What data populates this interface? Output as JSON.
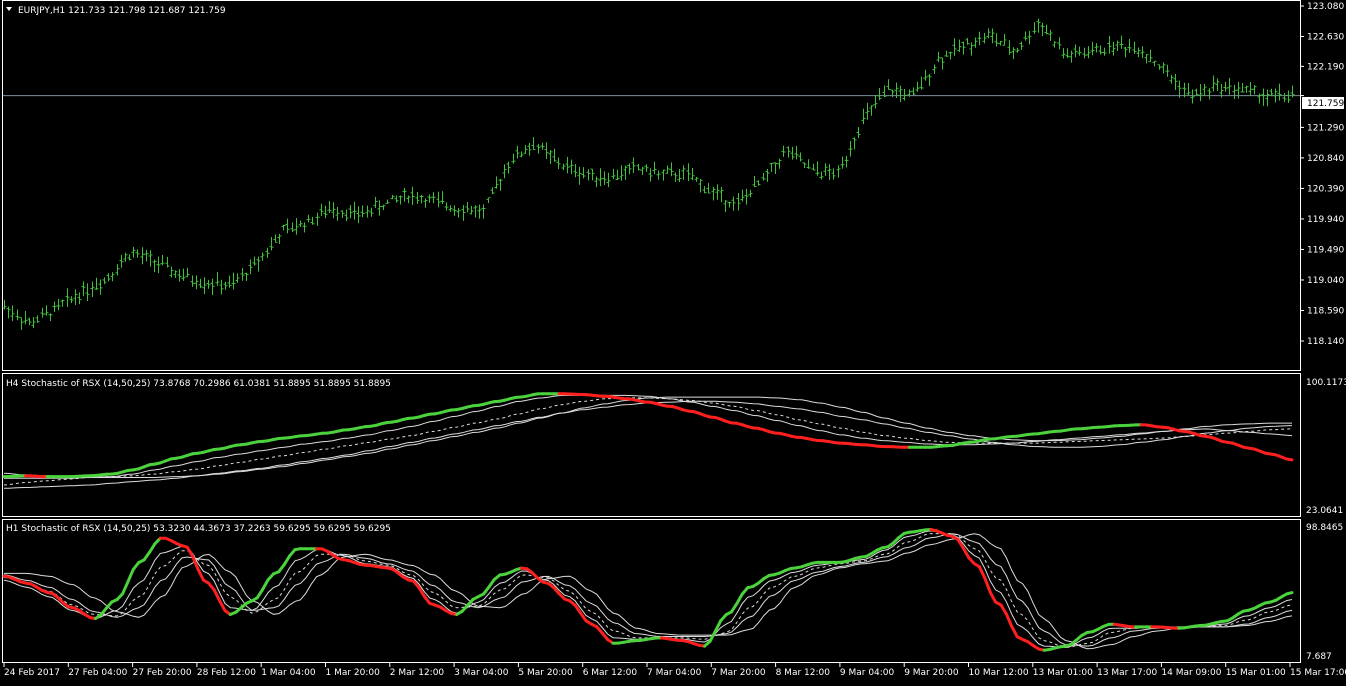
{
  "colors": {
    "background": "#000000",
    "frame": "#ffffff",
    "candle": "#41c03c",
    "rising": "#4bd23d",
    "falling": "#ff1f1f",
    "band": "#dcdcdc",
    "price_line": "#7d8ba0"
  },
  "main": {
    "symbol_menu_icon": "triangle-down-icon",
    "header": "EURJPY,H1  121.733 121.798 121.687 121.759",
    "price_tag": "121.759"
  },
  "h4": {
    "header": "H4 Stochastic of RSX (14,50,25) 73.8768 70.2986 61.0381 51.8895 51.8895 51.8895",
    "top_label": "100.1173",
    "bottom_label": "23.0641"
  },
  "h1": {
    "header": "H1 Stochastic of RSX (14,50,25) 53.3230 44.3673 37.2263 59.6295 59.6295 59.6295",
    "top_label": "98.8465",
    "bottom_label": "7.687"
  },
  "chart_data": [
    {
      "type": "ohlc",
      "title": "EURJPY,H1",
      "ylim": [
        118.14,
        123.08
      ],
      "y_ticks": [
        "123.080",
        "122.630",
        "122.190",
        "121.759",
        "121.290",
        "120.840",
        "120.390",
        "119.940",
        "119.490",
        "119.040",
        "118.590",
        "118.140"
      ],
      "x_tick_labels": [
        "24 Feb 2017",
        "27 Feb 04:00",
        "27 Feb 20:00",
        "28 Feb 12:00",
        "1 Mar 04:00",
        "1 Mar 20:00",
        "2 Mar 12:00",
        "3 Mar 04:00",
        "5 Mar 20:00",
        "6 Mar 12:00",
        "7 Mar 04:00",
        "7 Mar 20:00",
        "8 Mar 12:00",
        "9 Mar 04:00",
        "9 Mar 20:00",
        "10 Mar 12:00",
        "13 Mar 01:00",
        "13 Mar 17:00",
        "14 Mar 09:00",
        "15 Mar 01:00",
        "15 Mar 17:00"
      ],
      "last_price": 121.759,
      "close_path": [
        118.65,
        118.4,
        118.6,
        118.85,
        119.05,
        119.45,
        119.3,
        119.1,
        119.0,
        118.95,
        119.3,
        119.75,
        119.9,
        120.1,
        120.0,
        120.15,
        120.3,
        120.2,
        120.1,
        120.05,
        120.8,
        121.05,
        120.75,
        120.6,
        120.55,
        120.7,
        120.6,
        120.6,
        120.35,
        120.15,
        120.5,
        120.95,
        120.65,
        120.6,
        121.4,
        121.85,
        121.75,
        122.3,
        122.5,
        122.65,
        122.4,
        122.85,
        122.35,
        122.4,
        122.5,
        122.45,
        122.1,
        121.75,
        121.9,
        121.85,
        121.75,
        121.759
      ]
    },
    {
      "type": "line",
      "title": "H4 Stochastic of RSX (14,50,25)",
      "ylim": [
        23.0641,
        100.1173
      ],
      "series": [
        {
          "values": [
            43,
            43.5,
            43,
            43,
            43.5,
            44.5,
            47,
            50.5,
            54,
            57,
            59.5,
            62,
            64,
            66,
            67.5,
            69,
            71,
            73,
            75.5,
            78,
            80.5,
            83,
            85.5,
            88,
            90.5,
            92.5,
            92.5,
            92,
            91,
            89.5,
            87.5,
            85,
            82,
            78.5,
            75,
            72,
            69,
            66.5,
            64.5,
            63,
            62,
            61,
            60.5,
            60.5,
            61.5,
            63.5,
            65.5,
            67,
            68.5,
            70,
            71.5,
            72.5,
            73.5,
            74,
            72.5,
            70,
            67,
            63.5,
            60,
            56.5,
            53
          ]
        },
        {
          "values": [
            42,
            42,
            42,
            42,
            42.5,
            43,
            44.5,
            47,
            49.5,
            52,
            54.5,
            56.5,
            58.5,
            60.5,
            62.5,
            64,
            66,
            68,
            70.5,
            73,
            76,
            79,
            82,
            85,
            88,
            90,
            91.5,
            91.5,
            91.5,
            91.5,
            91,
            89.5,
            87.5,
            85,
            82.5,
            79.5,
            76.5,
            73.5,
            70.5,
            68,
            66,
            64.5,
            63.5,
            62.5,
            62,
            62,
            62.5,
            63,
            64,
            65,
            66,
            67,
            68,
            69,
            70,
            71,
            71.5,
            70.5,
            69.5,
            68.5,
            67.5
          ]
        },
        {
          "values": [
            38,
            39.5,
            40.5,
            41.5,
            42.5,
            43,
            43.5,
            44.5,
            46,
            47.5,
            49.5,
            51.5,
            53.5,
            55.5,
            57.5,
            59.5,
            61.5,
            63.5,
            65.5,
            67.5,
            70,
            72.5,
            75,
            77.5,
            80.5,
            83.5,
            86,
            88,
            89.5,
            90,
            90,
            89.5,
            88.5,
            87,
            85,
            82.5,
            80,
            77,
            74.5,
            72,
            69.5,
            67.5,
            66,
            64.5,
            63.5,
            63,
            63,
            63,
            63,
            63.5,
            64,
            64.5,
            65,
            65.5,
            66,
            67,
            68,
            69,
            70,
            71,
            71.5
          ]
        },
        {
          "values": [
            36,
            36.5,
            37,
            37.5,
            38,
            39,
            40,
            41,
            42,
            43.5,
            45,
            46.5,
            48,
            50,
            52,
            54,
            56,
            58.5,
            61,
            63.5,
            66,
            68.5,
            71,
            73.5,
            76,
            78.5,
            81,
            83,
            84.5,
            86,
            87,
            87.5,
            88,
            88,
            87.5,
            86.5,
            85,
            83.5,
            81.5,
            79,
            77,
            74.5,
            72,
            69.5,
            67.5,
            65.5,
            63.5,
            62,
            61,
            60.5,
            60.5,
            61,
            62,
            63.5,
            65,
            67,
            69,
            70.5,
            72,
            73,
            73.5
          ]
        },
        {
          "values": [
            45,
            44,
            43.5,
            43,
            42.5,
            42.5,
            42.5,
            42.5,
            43,
            43.5,
            44.5,
            46,
            47.5,
            49,
            51,
            53,
            55,
            57,
            59.5,
            62,
            64.5,
            67,
            69.5,
            72,
            75,
            78,
            81,
            84,
            86.5,
            88.5,
            90,
            90.5,
            90.5,
            90.5,
            90.5,
            90.5,
            90,
            89,
            87,
            84.5,
            81.5,
            78,
            75,
            72,
            69.5,
            67.5,
            66,
            65,
            64.5,
            64.5,
            65,
            66,
            67,
            68.5,
            70,
            71.5,
            73,
            74,
            74.5,
            75,
            75
          ]
        }
      ]
    },
    {
      "type": "line",
      "title": "H1 Stochastic of RSX (14,50,25)",
      "ylim": [
        7.687,
        98.8465
      ],
      "series": [
        {
          "values": [
            63,
            58,
            51,
            40,
            32,
            46,
            73,
            91,
            85,
            58,
            35,
            45,
            65,
            83,
            83,
            75,
            71,
            69,
            60,
            42,
            35,
            48,
            64,
            69,
            58,
            45,
            28,
            14,
            16,
            18,
            16,
            12,
            35,
            55,
            64,
            69,
            73,
            73,
            77,
            84,
            95,
            97,
            92,
            72,
            43,
            17,
            9,
            12,
            22,
            28,
            26,
            26,
            25,
            27,
            30,
            38,
            44,
            51
          ]
        },
        {
          "values": [
            60,
            55,
            48,
            38,
            32,
            38,
            58,
            80,
            85,
            65,
            40,
            38,
            55,
            75,
            83,
            78,
            72,
            70,
            62,
            46,
            36,
            44,
            58,
            67,
            60,
            48,
            32,
            18,
            17,
            18,
            17,
            15,
            28,
            48,
            60,
            66,
            71,
            73,
            75,
            82,
            92,
            96,
            93,
            78,
            52,
            26,
            12,
            11,
            18,
            25,
            25,
            26,
            25,
            26,
            28,
            34,
            40,
            46
          ]
        },
        {
          "values": [
            62,
            58,
            52,
            42,
            35,
            34,
            48,
            70,
            82,
            71,
            48,
            36,
            46,
            66,
            79,
            79,
            74,
            71,
            64,
            51,
            40,
            41,
            53,
            64,
            62,
            52,
            37,
            23,
            18,
            18,
            18,
            17,
            22,
            40,
            55,
            63,
            69,
            72,
            74,
            79,
            88,
            94,
            94,
            83,
            61,
            35,
            16,
            11,
            14,
            22,
            25,
            26,
            26,
            26,
            27,
            31,
            37,
            42
          ]
        },
        {
          "values": [
            64,
            60,
            55,
            46,
            37,
            33,
            40,
            60,
            77,
            75,
            55,
            38,
            40,
            57,
            73,
            79,
            76,
            72,
            67,
            56,
            44,
            40,
            47,
            59,
            63,
            56,
            43,
            29,
            21,
            19,
            19,
            19,
            21,
            33,
            49,
            60,
            66,
            70,
            73,
            77,
            84,
            91,
            94,
            88,
            71,
            45,
            23,
            13,
            12,
            18,
            23,
            25,
            26,
            26,
            26,
            28,
            33,
            38
          ]
        },
        {
          "values": [
            65,
            65,
            63,
            57,
            47,
            37,
            33,
            48,
            70,
            79,
            66,
            45,
            35,
            45,
            64,
            77,
            79,
            75,
            71,
            64,
            52,
            41,
            40,
            50,
            61,
            63,
            52,
            36,
            25,
            21,
            20,
            20,
            20,
            24,
            39,
            55,
            64,
            69,
            72,
            74,
            80,
            86,
            90,
            94,
            84,
            58,
            32,
            16,
            10,
            13,
            19,
            23,
            25,
            26,
            26,
            27,
            30,
            34
          ]
        }
      ]
    }
  ]
}
